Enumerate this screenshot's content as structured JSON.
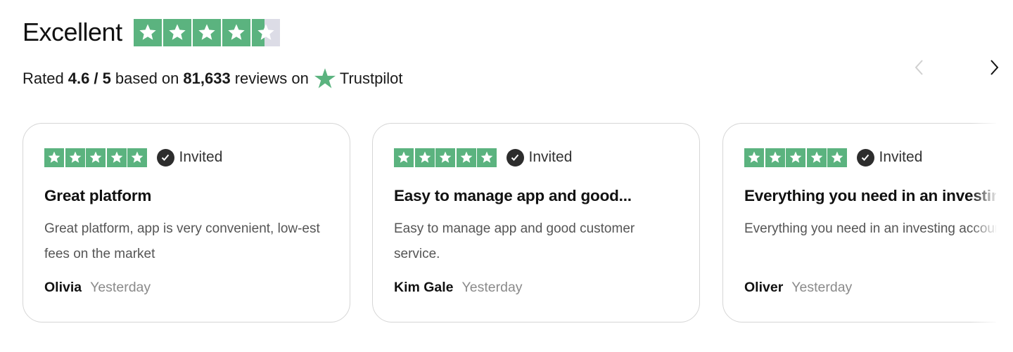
{
  "header": {
    "rating_word": "Excellent",
    "star_rating": 4.6,
    "star_count": 5,
    "star_color": "#5bb37f",
    "empty_color": "#dcdce6"
  },
  "summary": {
    "prefix": "Rated",
    "score": "4.6 / 5",
    "mid": "based on",
    "count": "81,633",
    "suffix": "reviews on",
    "brand": "Trustpilot",
    "brand_icon": "trustpilot-star-icon"
  },
  "navigation": {
    "prev_icon": "chevron-left-icon",
    "next_icon": "chevron-right-icon"
  },
  "reviews": [
    {
      "stars": 5,
      "badge": "Invited",
      "title": "Great platform",
      "body": "Great platform, app is very convenient, low-est fees on the market",
      "author": "Olivia",
      "date": "Yesterday"
    },
    {
      "stars": 5,
      "badge": "Invited",
      "title": "Easy to manage app and good...",
      "body": "Easy to manage app and good customer service.",
      "author": "Kim Gale",
      "date": "Yesterday"
    },
    {
      "stars": 5,
      "badge": "Invited",
      "title": "Everything you need in an investing",
      "body": "Everything you need in an investing account. Great UI.",
      "author": "Oliver",
      "date": "Yesterday"
    }
  ]
}
